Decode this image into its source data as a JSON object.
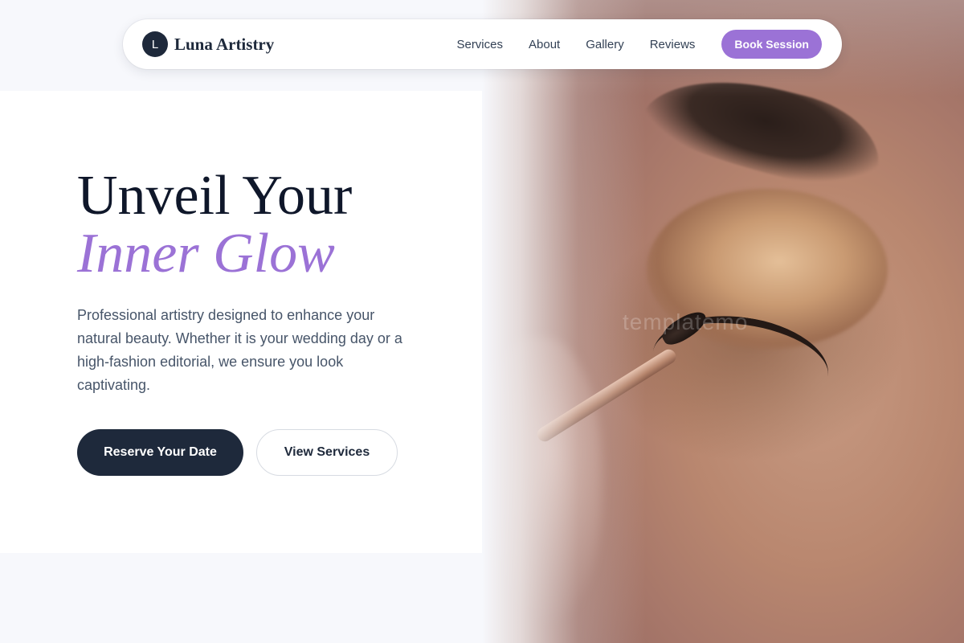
{
  "brand": {
    "mark": "L",
    "name": "Luna Artistry"
  },
  "nav": {
    "links": [
      "Services",
      "About",
      "Gallery",
      "Reviews"
    ],
    "cta": "Book Session"
  },
  "hero": {
    "headline_line1": "Unveil Your",
    "headline_line2": "Inner Glow",
    "description": "Professional artistry designed to enhance your natural beauty. Whether it is your wedding day or a high-fashion editorial, we ensure you look captivating.",
    "primary_button": "Reserve Your Date",
    "secondary_button": "View Services"
  },
  "image": {
    "watermark": "templatemo"
  },
  "colors": {
    "accent": "#9b72d6",
    "dark": "#1e293b",
    "text": "#475569",
    "background": "#f7f8fc"
  },
  "icons": {
    "brand_mark": "monogram-circle-icon"
  }
}
